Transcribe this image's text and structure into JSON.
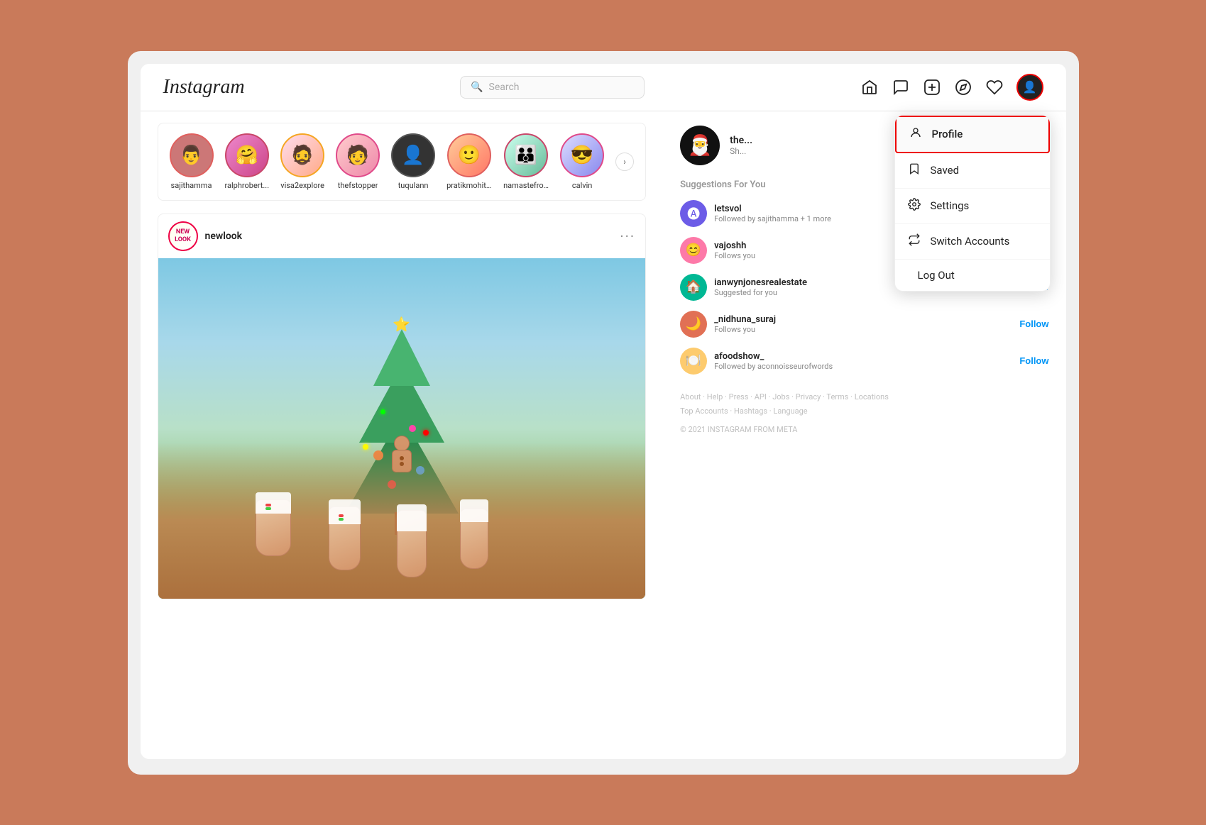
{
  "app": {
    "logo": "Instagram"
  },
  "header": {
    "search_placeholder": "Search",
    "nav_icons": [
      "home",
      "messenger",
      "add",
      "explore",
      "heart",
      "profile"
    ]
  },
  "dropdown": {
    "items": [
      {
        "id": "profile",
        "label": "Profile",
        "icon": "person",
        "active": true
      },
      {
        "id": "saved",
        "label": "Saved",
        "icon": "bookmark"
      },
      {
        "id": "settings",
        "label": "Settings",
        "icon": "gear"
      },
      {
        "id": "switch",
        "label": "Switch Accounts",
        "icon": "switch"
      },
      {
        "id": "logout",
        "label": "Log Out",
        "icon": "logout"
      }
    ]
  },
  "stories": [
    {
      "username": "sajithamma",
      "color": "#e0605e"
    },
    {
      "username": "ralphrobert...",
      "color": "#c9476a"
    },
    {
      "username": "visa2explore",
      "color": "#f5a623"
    },
    {
      "username": "thefstopper",
      "color": "#e04a8a"
    },
    {
      "username": "tuqulann",
      "color": "#444"
    },
    {
      "username": "pratikmohit...",
      "color": "#e0605e"
    },
    {
      "username": "namastefro...",
      "color": "#c9476a"
    },
    {
      "username": "calvin",
      "color": "#e04a8a"
    }
  ],
  "post": {
    "username": "newlook",
    "avatar_text": "NEW\nLOOK",
    "more_icon": "⋯"
  },
  "sidebar": {
    "user": {
      "username": "the...",
      "subtext": "Sh...",
      "avatar_emoji": "🎅"
    },
    "suggestions_title": "Suggestions For You",
    "suggestions": [
      {
        "username": "letsvol",
        "sub": "Followed by sajithamma + 1 more",
        "follow": false,
        "avatar_color": "#6c5ce7"
      },
      {
        "username": "vajoshh",
        "sub": "Follows you",
        "follow": true,
        "follow_label": "Follow",
        "avatar_color": "#fd79a8"
      },
      {
        "username": "ianwynjonesrealestate",
        "sub": "Suggested for you",
        "follow": true,
        "follow_label": "Follow",
        "avatar_color": "#00b894"
      },
      {
        "username": "_nidhuna_suraj",
        "sub": "Follows you",
        "follow": true,
        "follow_label": "Follow",
        "avatar_color": "#e17055"
      },
      {
        "username": "afoodshow_",
        "sub": "Followed by aconnoisseurofwords",
        "follow": true,
        "follow_label": "Follow",
        "avatar_color": "#fdcb6e"
      }
    ],
    "footer_links": [
      "About",
      "Help",
      "Press",
      "API",
      "Jobs",
      "Privacy",
      "Terms",
      "Locations",
      "Top Accounts",
      "Hashtags",
      "Language"
    ],
    "copyright": "© 2021 INSTAGRAM FROM META"
  }
}
